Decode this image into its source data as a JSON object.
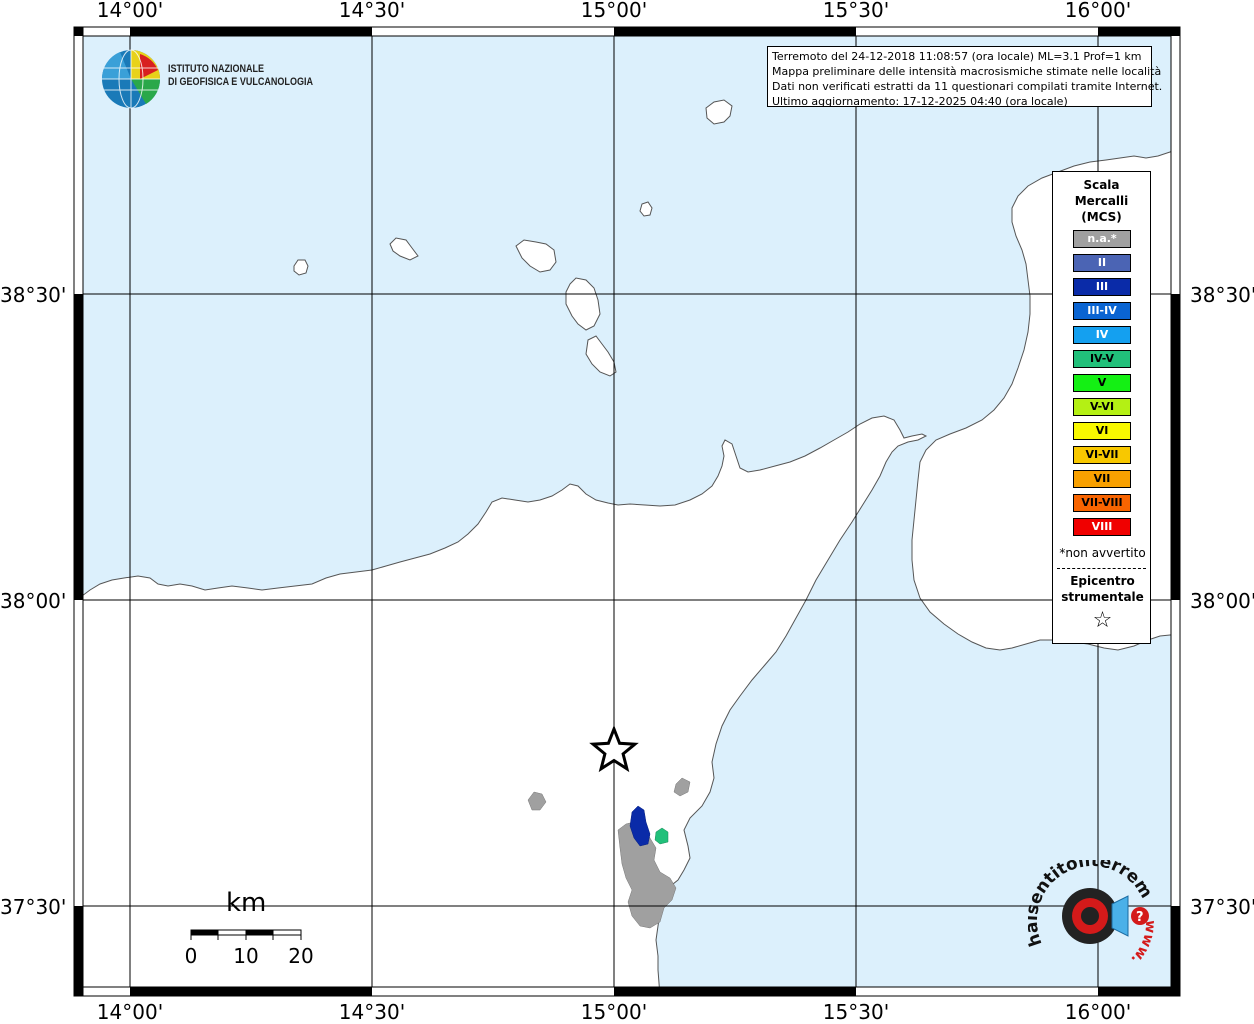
{
  "map": {
    "lon_labels": [
      "14°00'",
      "14°30'",
      "15°00'",
      "15°30'",
      "16°00'"
    ],
    "lat_labels": [
      "38°30'",
      "38°00'",
      "37°30'"
    ],
    "colors": {
      "sea": "#dcf0fc",
      "land": "#ffffff",
      "grid": "#000000",
      "unfelt_area": "#a0a0a0",
      "intensity_III": "#0a2ba8",
      "intensity_IV_V": "#21c07a"
    }
  },
  "logo": {
    "line1": "ISTITUTO NAZIONALE",
    "line2": "DI GEOFISICA E VULCANOLOGIA"
  },
  "info": {
    "line1": "Terremoto del 24-12-2018 11:08:57 (ora locale) ML=3.1 Prof=1 km",
    "line2": "Mappa preliminare delle intensità macrosismiche stimate nelle località",
    "line3": "Dati non verificati estratti da 11 questionari compilati tramite Internet.",
    "line4": "Ultimo aggiornamento: 17-12-2025 04:40 (ora locale)"
  },
  "legend": {
    "title_line1": "Scala",
    "title_line2": "Mercalli",
    "title_line3": "(MCS)",
    "items": [
      {
        "label": "n.a.*",
        "color": "#a0a0a0",
        "text_color": "#ffffff"
      },
      {
        "label": "II",
        "color": "#4b64b4",
        "text_color": "#ffffff"
      },
      {
        "label": "III",
        "color": "#0a2ba8",
        "text_color": "#ffffff"
      },
      {
        "label": "III-IV",
        "color": "#0a64d2",
        "text_color": "#ffffff"
      },
      {
        "label": "IV",
        "color": "#14a0f0",
        "text_color": "#ffffff"
      },
      {
        "label": "IV-V",
        "color": "#21c07a",
        "text_color": "#000000"
      },
      {
        "label": "V",
        "color": "#14f014",
        "text_color": "#000000"
      },
      {
        "label": "V-VI",
        "color": "#b4f014",
        "text_color": "#000000"
      },
      {
        "label": "VI",
        "color": "#f8f800",
        "text_color": "#000000"
      },
      {
        "label": "VI-VII",
        "color": "#f8c800",
        "text_color": "#000000"
      },
      {
        "label": "VII",
        "color": "#f8a000",
        "text_color": "#000000"
      },
      {
        "label": "VII-VIII",
        "color": "#f86400",
        "text_color": "#000000"
      },
      {
        "label": "VIII",
        "color": "#f00000",
        "text_color": "#ffffff"
      }
    ],
    "note": "*non avvertito",
    "epicenter_line1": "Epicentro",
    "epicenter_line2": "strumentale",
    "epicenter_symbol": "☆"
  },
  "scale_bar": {
    "unit": "km",
    "labels": [
      "0",
      "10",
      "20"
    ]
  },
  "badge": {
    "text": "haisentitoilterremoto.it",
    "url": "www."
  }
}
